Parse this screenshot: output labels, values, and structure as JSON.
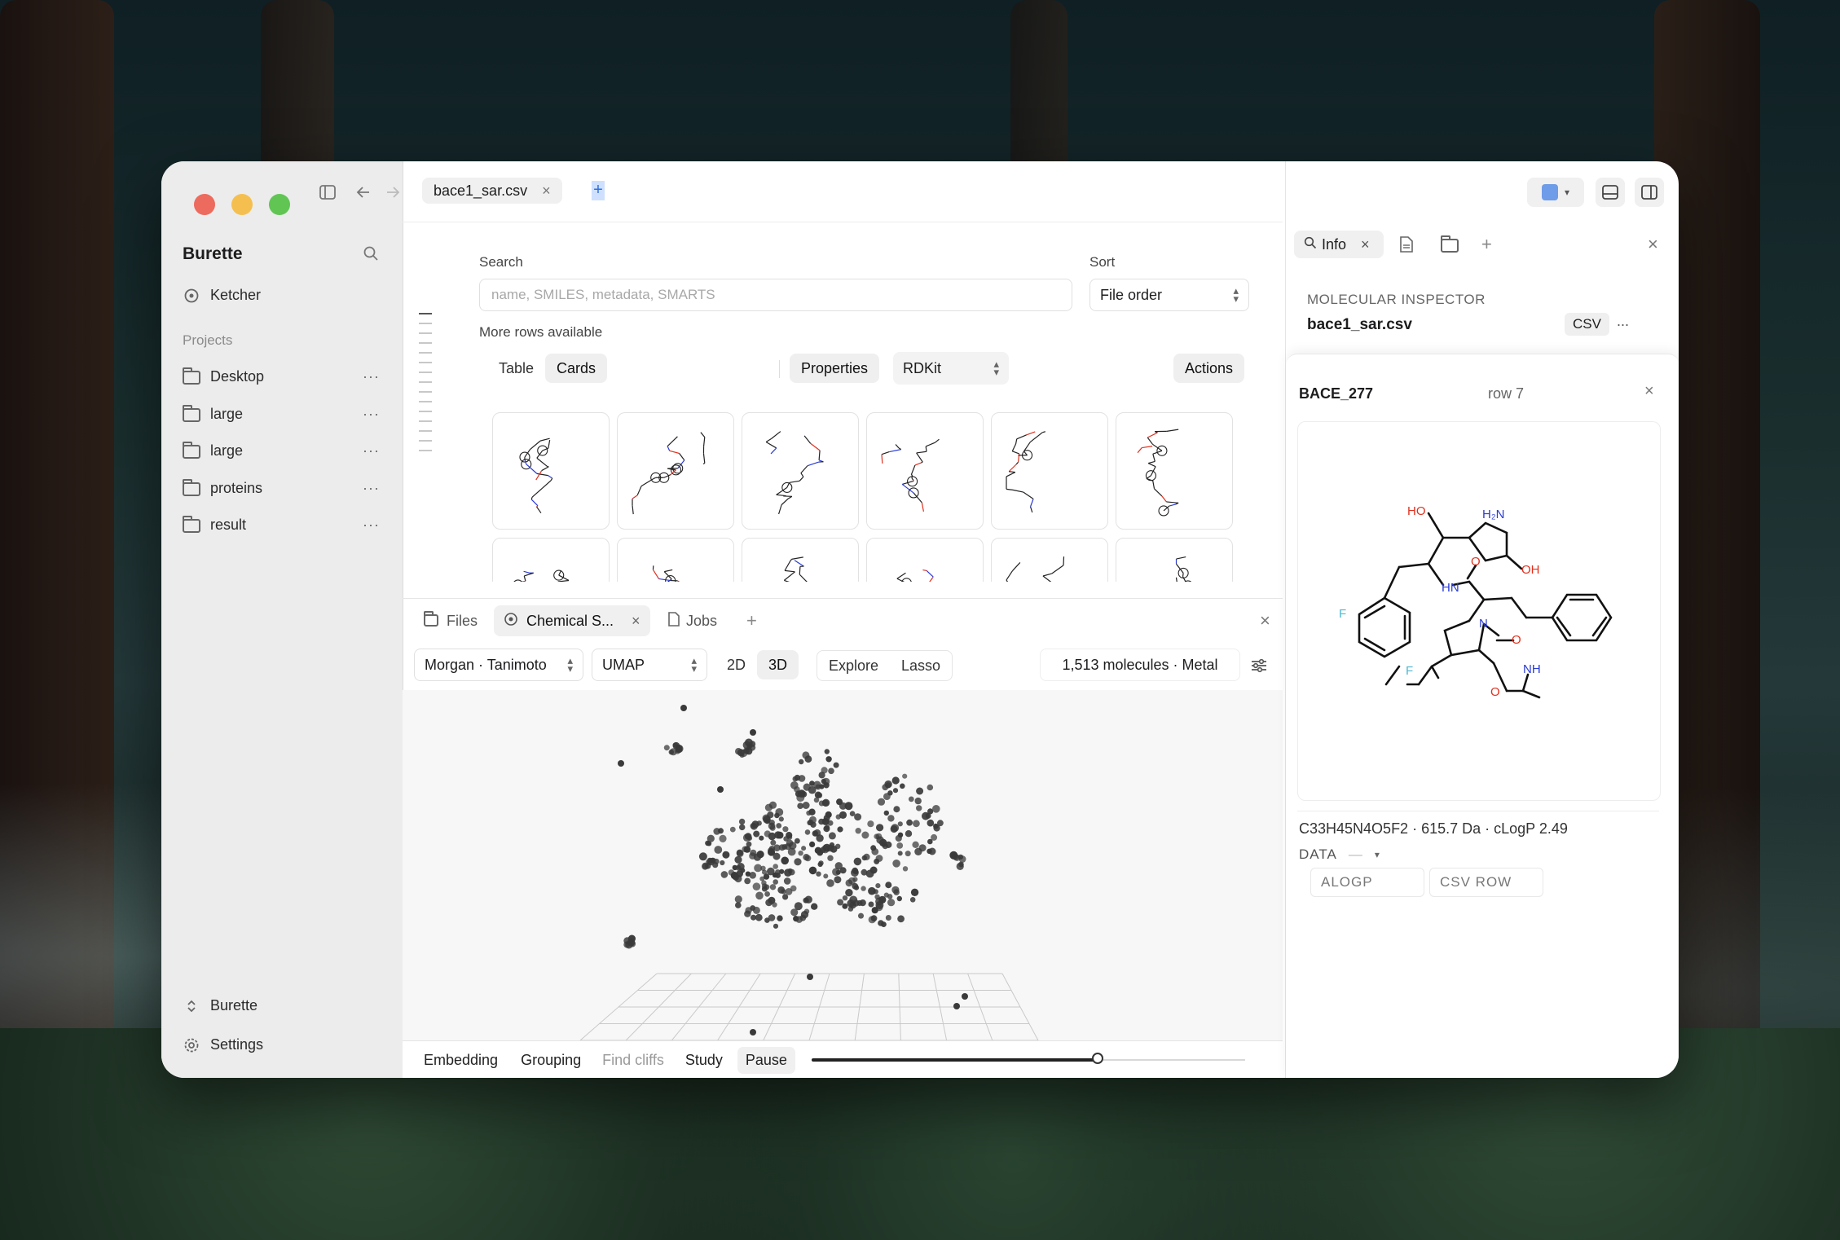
{
  "sidebar": {
    "app_name": "Burette",
    "ketcher_label": "Ketcher",
    "projects_label": "Projects",
    "projects": [
      {
        "name": "Desktop",
        "menu": "···"
      },
      {
        "name": "large",
        "menu": "···"
      },
      {
        "name": "large",
        "menu": "···"
      },
      {
        "name": "proteins",
        "menu": "···"
      },
      {
        "name": "result",
        "menu": "···"
      }
    ],
    "workspace_label": "Burette",
    "settings_label": "Settings"
  },
  "tabs": {
    "file_tab": "bace1_sar.csv",
    "close_glyph": "×",
    "new_tab_glyph": "+"
  },
  "search": {
    "label": "Search",
    "placeholder": "name, SMILES, metadata, SMARTS",
    "more_rows": "More rows available"
  },
  "sort": {
    "label": "Sort",
    "value": "File order"
  },
  "view_modes": {
    "table": "Table",
    "cards": "Cards",
    "properties": "Properties",
    "renderer": "RDKit",
    "actions": "Actions"
  },
  "bottom_panel": {
    "tabs": [
      {
        "label": "Files"
      },
      {
        "label": "Chemical S..."
      },
      {
        "label": "Jobs"
      }
    ],
    "add_glyph": "+",
    "close_glyph": "×",
    "fingerprint": "Morgan · Tanimoto",
    "reduction": "UMAP",
    "dim_2d": "2D",
    "dim_3d": "3D",
    "explore": "Explore",
    "lasso": "Lasso",
    "summary": "1,513 molecules · Metal",
    "status": {
      "embedding": "Embedding",
      "grouping": "Grouping",
      "find_cliffs": "Find cliffs",
      "study": "Study",
      "pause": "Pause"
    },
    "slider_value": 0.66
  },
  "right_panel": {
    "info_tab": "Info",
    "close_glyph": "×",
    "add_glyph": "+",
    "inspector_heading": "MOLECULAR INSPECTOR",
    "inspector_file": "bace1_sar.csv",
    "inspector_badge": "CSV",
    "inspector_menu": "...",
    "molecule_name": "BACE_277",
    "molecule_row": "row 7",
    "formula_line": "C33H45N4O5F2 · 615.7 Da · cLogP 2.49",
    "data_label": "DATA",
    "data_dash": "—",
    "data_columns": [
      "ALOGP",
      "CSV ROW"
    ]
  },
  "colors": {
    "red": "#ed6a5e",
    "yellow": "#f5bf4f",
    "green": "#61c554",
    "oxygen": "#e0301e",
    "nitrogen": "#2a3bd6",
    "fluorine": "#4fb8cf"
  }
}
